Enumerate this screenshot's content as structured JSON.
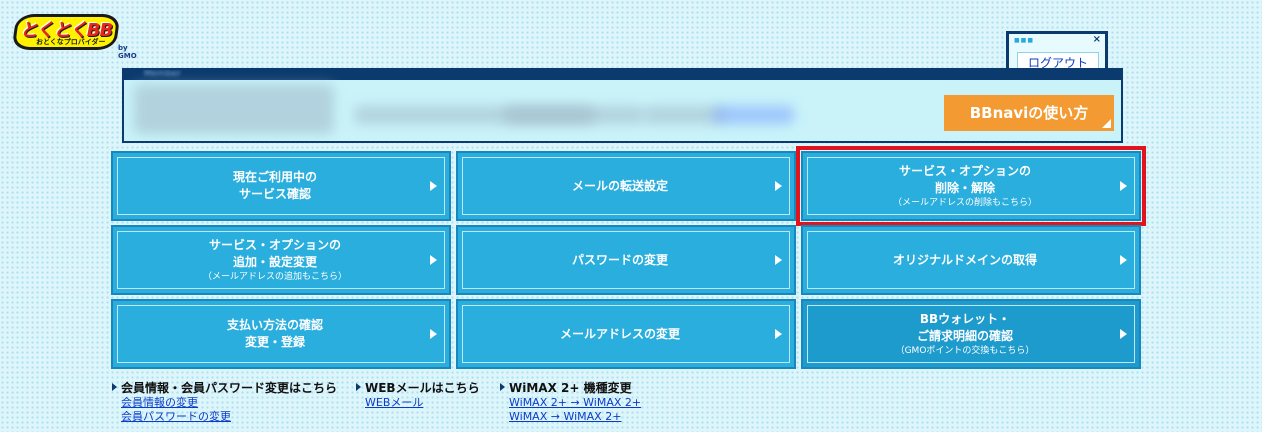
{
  "logo": {
    "text": "とくとくBB",
    "subtitle": "おとくなプロバイダー",
    "brand": "by GMO"
  },
  "logout": {
    "label": "ログアウト"
  },
  "member_panel": {
    "header_label": "Member",
    "help_button": "BBnaviの使い方"
  },
  "tiles": [
    {
      "lines": [
        "現在ご利用中の",
        "サービス確認"
      ],
      "note": ""
    },
    {
      "lines": [
        "メールの転送設定"
      ],
      "note": ""
    },
    {
      "lines": [
        "サービス・オプションの",
        "削除・解除"
      ],
      "note": "（メールアドレスの削除もこちら）"
    },
    {
      "lines": [
        "サービス・オプションの",
        "追加・設定変更"
      ],
      "note": "（メールアドレスの追加もこちら）"
    },
    {
      "lines": [
        "パスワードの変更"
      ],
      "note": ""
    },
    {
      "lines": [
        "オリジナルドメインの取得"
      ],
      "note": ""
    },
    {
      "lines": [
        "支払い方法の確認",
        "変更・登録"
      ],
      "note": ""
    },
    {
      "lines": [
        "メールアドレスの変更"
      ],
      "note": ""
    },
    {
      "lines": [
        "BBウォレット・",
        "ご請求明細の確認"
      ],
      "note": "（GMOポイントの交換もこちら）"
    }
  ],
  "footer": {
    "member": {
      "title": "会員情報・会員パスワード変更はこちら",
      "links": [
        "会員情報の変更",
        "会員パスワードの変更"
      ]
    },
    "webmail": {
      "title": "WEBメールはこちら",
      "links": [
        "WEBメール"
      ]
    },
    "wimax": {
      "title": "WiMAX 2+ 機種変更",
      "links": [
        "WiMAX 2+ → WiMAX 2+",
        "WiMAX → WiMAX 2+"
      ]
    }
  },
  "colors": {
    "tile": "#2aaede",
    "tile_alt": "#1d9bcc",
    "accent_orange": "#f39a32",
    "highlight": "#e0141a",
    "navy": "#0b3a6e"
  }
}
